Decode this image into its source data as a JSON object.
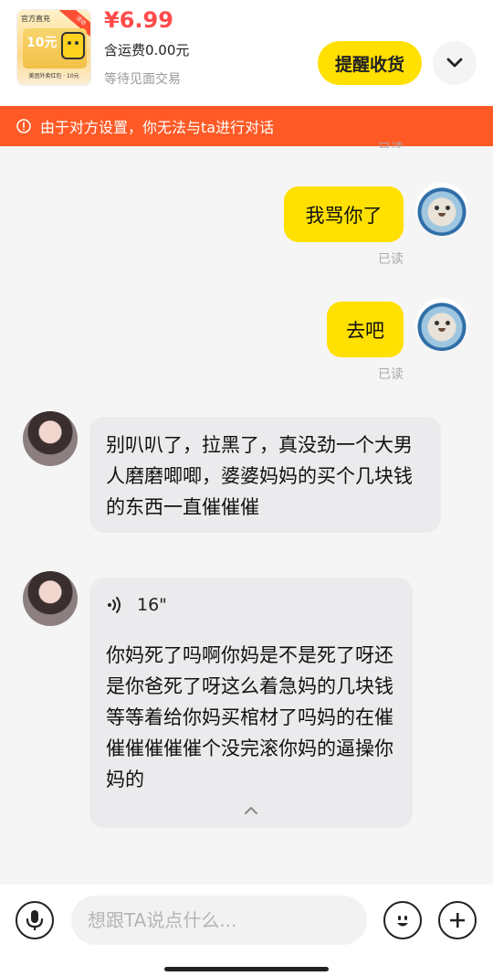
{
  "order": {
    "thumbnail": {
      "badge": "官方直充",
      "ribbon": "活动",
      "amount": "10元",
      "caption": "美团外卖红包 · 10元"
    },
    "price": "¥6.99",
    "shipping": "含运费0.00元",
    "status": "等待见面交易",
    "remind_button": "提醒收货",
    "more_icon": "chevron-down-icon"
  },
  "notice": {
    "icon": "info-icon",
    "text": "由于对方设置，你无法与ta进行对话"
  },
  "messages": [
    {
      "sender": "me",
      "text": "我骂你了",
      "read": "已读"
    },
    {
      "sender": "me",
      "text": "去吧",
      "read": "已读"
    },
    {
      "sender": "other",
      "text": "别叭叭了，拉黑了，真没劲一个大男人磨磨唧唧，婆婆妈妈的买个几块钱的东西一直催催催"
    },
    {
      "sender": "other",
      "type": "voice",
      "duration": "16\"",
      "transcript": "你妈死了吗啊你妈是不是死了呀还是你爸死了呀这么着急妈的几块钱等等着给你妈买棺材了吗妈的在催催催催催催个没完滚你妈的逼操你妈的"
    }
  ],
  "partial_read_label": "已读",
  "input_bar": {
    "placeholder": "想跟TA说点什么...",
    "voice_icon": "microphone-icon",
    "emoji_icon": "emoji-icon",
    "plus_icon": "plus-icon"
  },
  "colors": {
    "accent_yellow": "#ffe000",
    "price_red": "#ff4b4b",
    "banner_orange": "#ff5a26"
  }
}
